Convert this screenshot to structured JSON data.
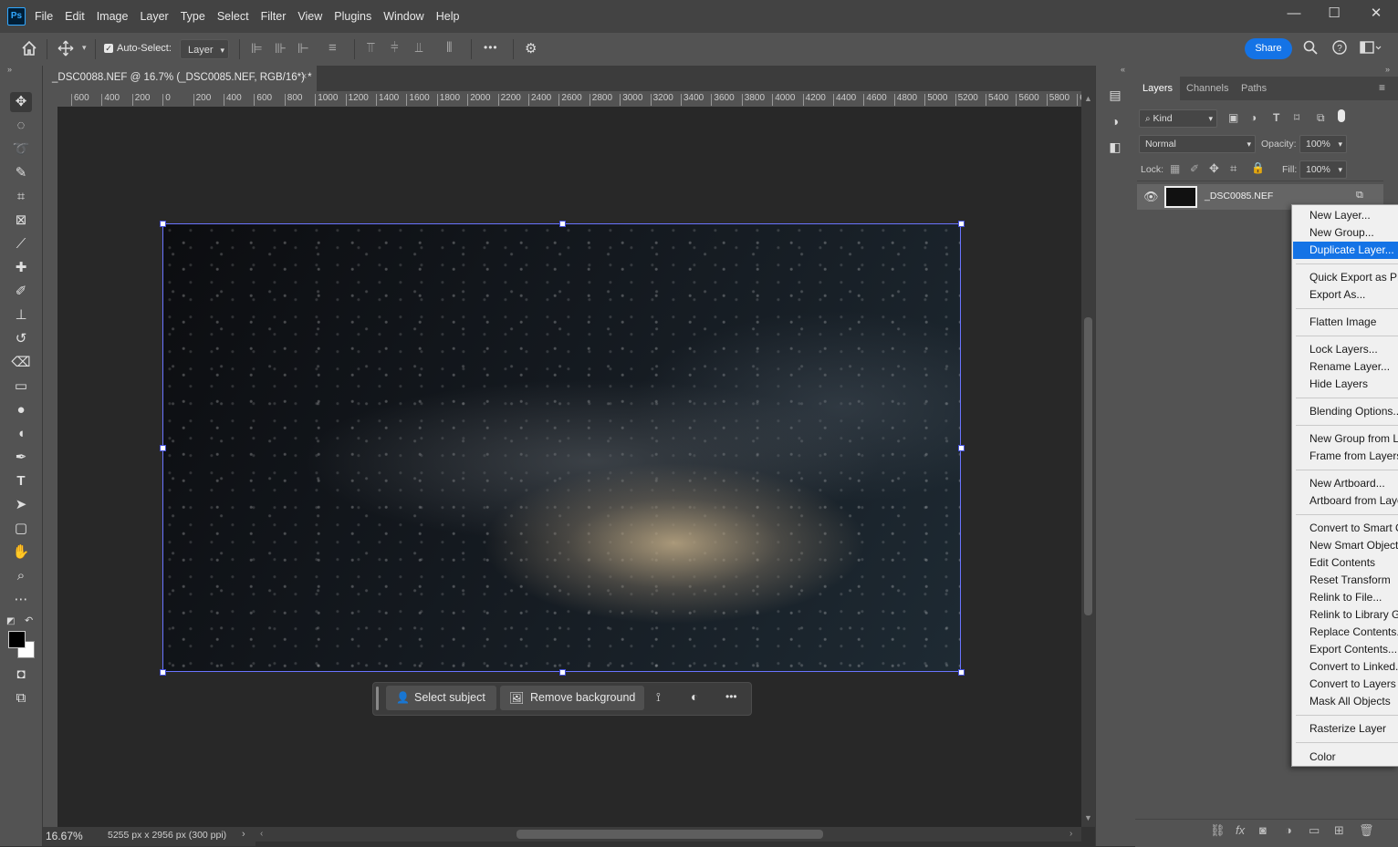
{
  "app": {
    "logo": "Ps",
    "menus": [
      "File",
      "Edit",
      "Image",
      "Layer",
      "Type",
      "Select",
      "Filter",
      "View",
      "Plugins",
      "Window",
      "Help"
    ]
  },
  "window_controls": {
    "minimize": "—",
    "maximize": "☐",
    "close": "✕"
  },
  "options_bar": {
    "auto_select_label": "Auto-Select:",
    "auto_select_checked": true,
    "auto_select_target": "Layer",
    "more_label": "•••",
    "share_label": "Share",
    "icons": [
      "home-icon",
      "move-tool-icon",
      "align-left-icon",
      "align-center-icon",
      "align-right-icon",
      "distribute-icon",
      "align-top-icon",
      "align-middle-icon",
      "align-bottom-icon",
      "distribute-vertical-icon",
      "more-icon",
      "settings-icon",
      "search-icon",
      "help-icon",
      "workspace-icon"
    ]
  },
  "document": {
    "tab_title": "_DSC0088.NEF @ 16.7% (_DSC0085.NEF, RGB/16*) *",
    "close": "×",
    "ruler_ticks": [
      "600",
      "400",
      "200",
      "0",
      "200",
      "400",
      "600",
      "800",
      "1000",
      "1200",
      "1400",
      "1600",
      "1800",
      "2000",
      "2200",
      "2400",
      "2600",
      "2800",
      "3000",
      "3200",
      "3400",
      "3600",
      "3800",
      "4000",
      "4200",
      "4400",
      "4600",
      "4800",
      "5000",
      "5200",
      "5400",
      "5600",
      "5800",
      "6"
    ],
    "image_subject": "milky-way-night-sky"
  },
  "task_bar": {
    "select_subject": "Select subject",
    "remove_background": "Remove background",
    "more": "•••"
  },
  "status": {
    "zoom": "16.67%",
    "doc_size": "5255 px x 2956 px (300 ppi)"
  },
  "colors": {
    "foreground": "#000000",
    "background": "#ffffff",
    "accent": "#1473e6"
  },
  "layers_panel": {
    "tabs": [
      "Layers",
      "Channels",
      "Paths"
    ],
    "filter_kind": "Kind",
    "blend_mode": "Normal",
    "opacity_label": "Opacity:",
    "opacity_value": "100%",
    "lock_label": "Lock:",
    "fill_label": "Fill:",
    "fill_value": "100%",
    "layer_name": "_DSC0085.NEF"
  },
  "context_menu": {
    "items": [
      "New Layer...",
      "New Group...",
      "Duplicate Layer...",
      "Quick Export as PNG",
      "Export As...",
      "Flatten Image",
      "Lock Layers...",
      "Rename Layer...",
      "Hide Layers",
      "Blending Options...",
      "New Group from Layers...",
      "Frame from Layers...",
      "New Artboard...",
      "Artboard from Layers...",
      "Convert to Smart Object",
      "New Smart Object via Copy",
      "Edit Contents",
      "Reset Transform",
      "Relink to File...",
      "Relink to Library Graphic...",
      "Replace Contents...",
      "Export Contents...",
      "Convert to Linked...",
      "Convert to Layers",
      "Mask All Objects",
      "Rasterize Layer",
      "Color"
    ],
    "highlighted": "Duplicate Layer..."
  }
}
